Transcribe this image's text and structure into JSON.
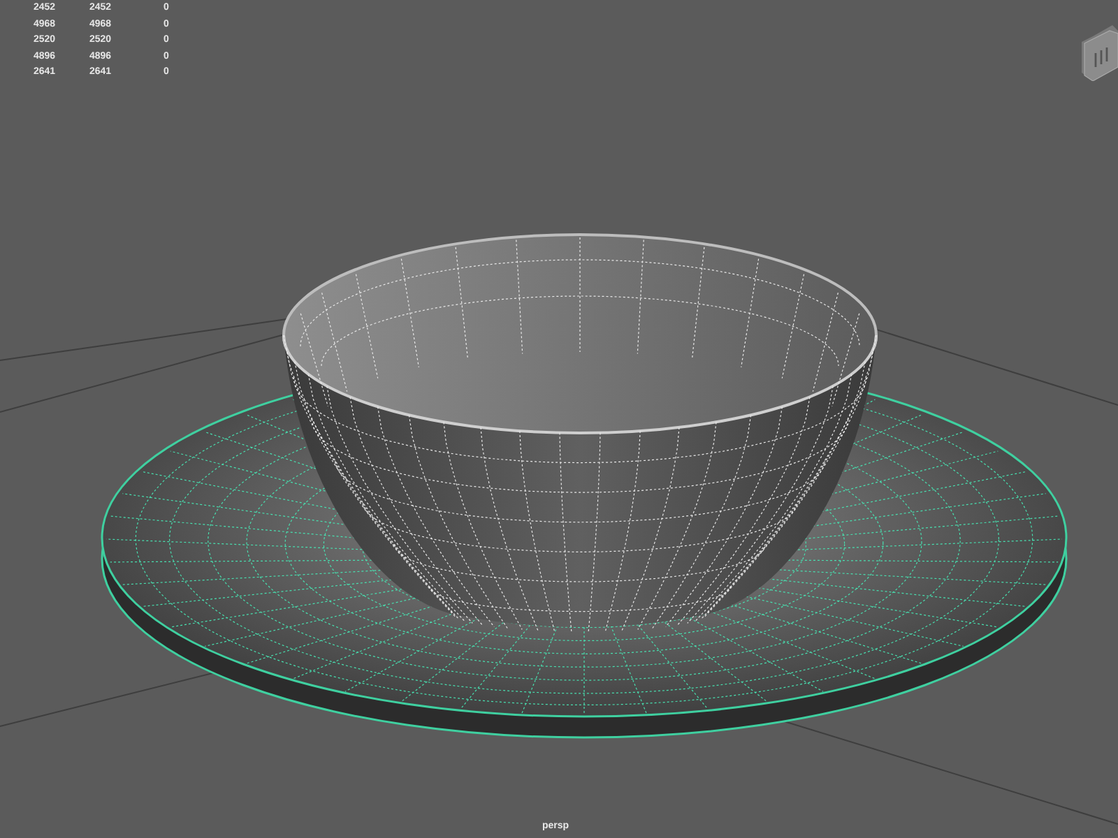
{
  "stats": [
    {
      "column_1": "2452",
      "column_2": "2452",
      "column_3": "0"
    },
    {
      "column_1": "4968",
      "column_2": "4968",
      "column_3": "0"
    },
    {
      "column_1": "2520",
      "column_2": "2520",
      "column_3": "0"
    },
    {
      "column_1": "4896",
      "column_2": "4896",
      "column_3": "0"
    },
    {
      "column_1": "2641",
      "column_2": "2641",
      "column_3": "0"
    }
  ],
  "camera_label": "persp"
}
